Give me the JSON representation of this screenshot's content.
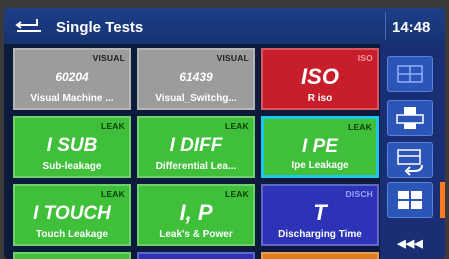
{
  "header": {
    "title": "Single Tests",
    "time": "14:48"
  },
  "tiles": [
    {
      "tag": "VISUAL",
      "symbol": "60204",
      "label": "Visual Machine ...",
      "color": "gray"
    },
    {
      "tag": "VISUAL",
      "symbol": "61439",
      "label": "Visual_Switchg...",
      "color": "gray"
    },
    {
      "tag": "ISO",
      "symbol": "ISO",
      "label": "R iso",
      "color": "red"
    },
    {
      "tag": "LEAK",
      "symbol": "I SUB",
      "label": "Sub-leakage",
      "color": "green"
    },
    {
      "tag": "LEAK",
      "symbol": "I DIFF",
      "label": "Differential Lea...",
      "color": "green"
    },
    {
      "tag": "LEAK",
      "symbol": "I PE",
      "label": "Ipe Leakage",
      "color": "green",
      "selected": true
    },
    {
      "tag": "LEAK",
      "symbol": "I TOUCH",
      "label": "Touch Leakage",
      "color": "green"
    },
    {
      "tag": "LEAK",
      "symbol": "I, P",
      "label": "Leak's & Power",
      "color": "green"
    },
    {
      "tag": "DISCH",
      "symbol": "T",
      "label": "Discharging Time",
      "color": "blue"
    }
  ],
  "rail": {
    "more_label": "◀◀◀",
    "accent_color": "#ff7b1c"
  }
}
